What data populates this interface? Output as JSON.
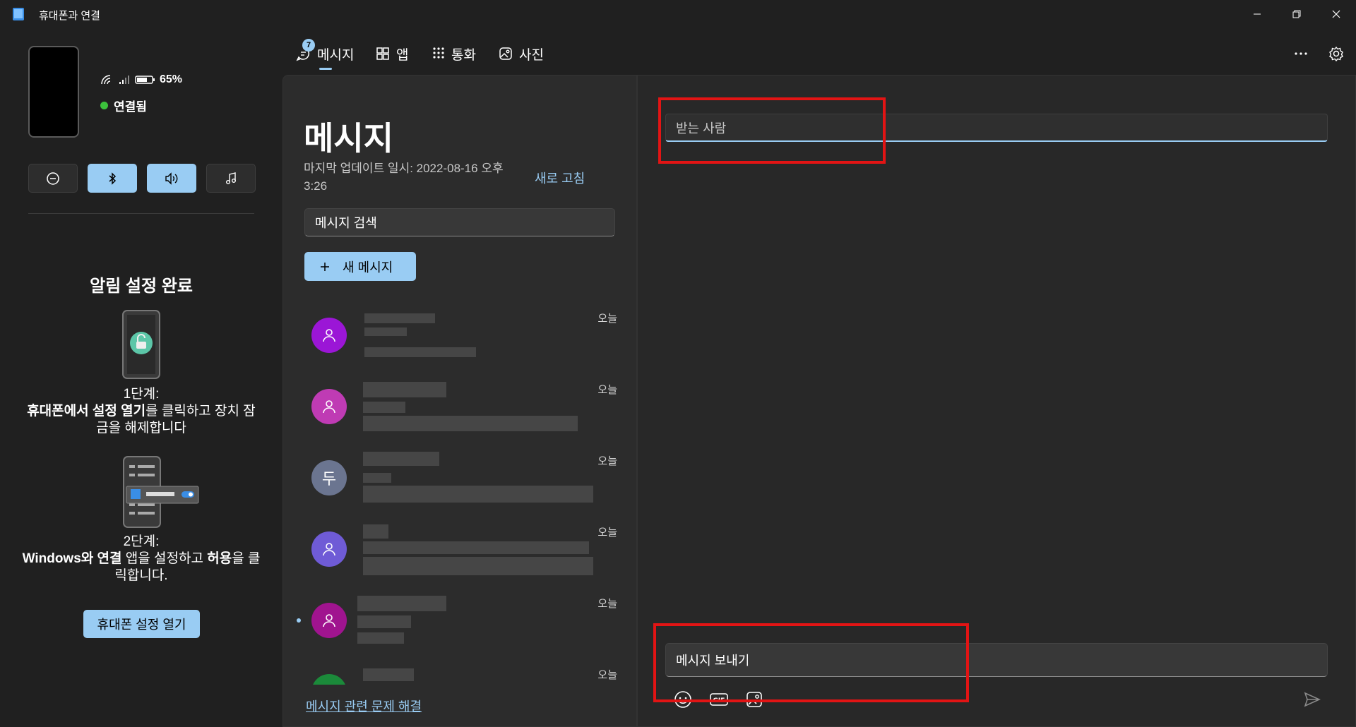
{
  "window": {
    "title": "휴대폰과 연결"
  },
  "device": {
    "battery": "65%",
    "status": "연결됨"
  },
  "quick_actions": [
    {
      "name": "do-not-disturb",
      "state": "off"
    },
    {
      "name": "bluetooth",
      "state": "on"
    },
    {
      "name": "audio",
      "state": "on"
    },
    {
      "name": "music",
      "state": "off"
    }
  ],
  "notification_setup": {
    "title": "알림 설정 완료",
    "step1_title": "1단계:",
    "step1_bold": "휴대폰에서 설정 열기",
    "step1_rest": "를 클릭하고 장치 잠금을 해제합니다",
    "step2_title": "2단계:",
    "step2_bold1": "Windows와 연결",
    "step2_mid": " 앱을 설정하고 ",
    "step2_bold2": "허용",
    "step2_rest": "을 클릭합니다.",
    "open_button": "휴대폰 설정 열기"
  },
  "tabs": [
    {
      "label": "메시지",
      "icon": "message-icon",
      "badge": "7",
      "selected": true
    },
    {
      "label": "앱",
      "icon": "apps-icon"
    },
    {
      "label": "통화",
      "icon": "dialpad-icon"
    },
    {
      "label": "사진",
      "icon": "photos-icon"
    }
  ],
  "messages": {
    "title": "메시지",
    "last_update": "마지막 업데이트 일시: 2022-08-16 오후 3:26",
    "refresh": "새로 고침",
    "search_placeholder": "메시지 검색",
    "new_message": "새 메시지",
    "troubleshoot": "메시지 관련 문제 해결",
    "conversations": [
      {
        "avatar_letter": "",
        "avatar_color": "#9b16d6",
        "time": "오늘",
        "unread": false
      },
      {
        "avatar_letter": "",
        "avatar_color": "#bf3bb4",
        "time": "오늘",
        "unread": false
      },
      {
        "avatar_letter": "두",
        "avatar_color": "#6b7590",
        "time": "오늘",
        "unread": false
      },
      {
        "avatar_letter": "",
        "avatar_color": "#6f5bd6",
        "time": "오늘",
        "unread": false
      },
      {
        "avatar_letter": "",
        "avatar_color": "#a0148f",
        "time": "오늘",
        "unread": true
      },
      {
        "avatar_letter": "",
        "avatar_color": "#1b8a3a",
        "time": "오늘",
        "unread": false
      }
    ]
  },
  "compose": {
    "to_placeholder": "받는 사람",
    "message_placeholder": "메시지 보내기"
  },
  "colors": {
    "accent": "#99ccf3",
    "highlight": "#e21414",
    "connected": "#3cc13c"
  }
}
